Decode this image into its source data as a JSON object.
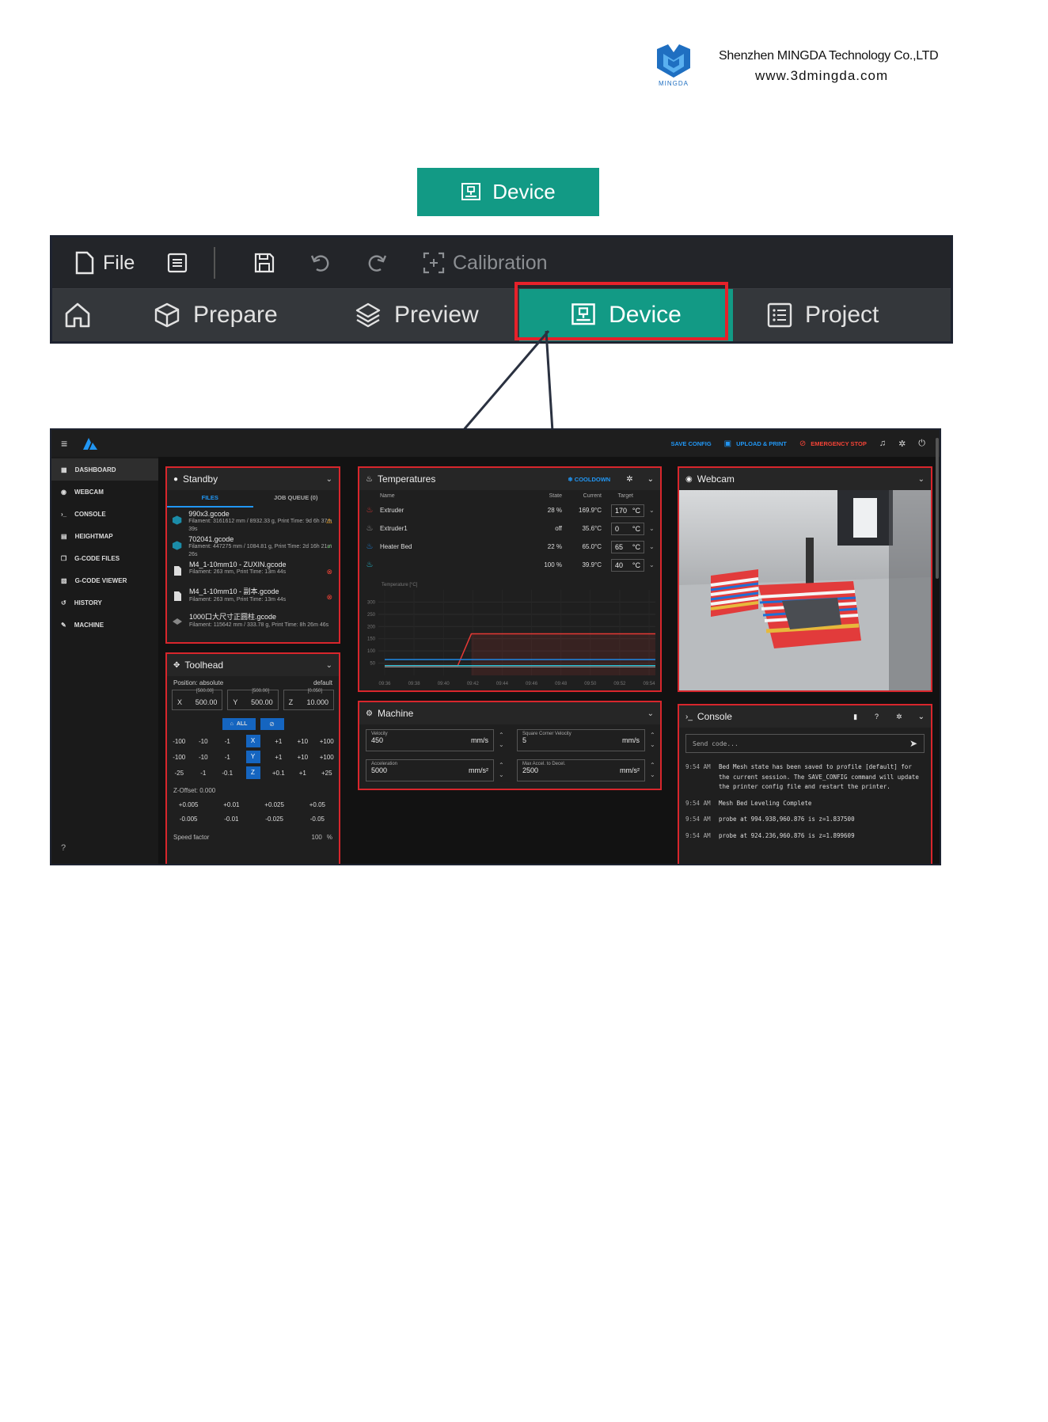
{
  "header": {
    "logo_text": "MINGDA",
    "company": "Shenzhen MINGDA Technology Co.,LTD",
    "website": "www.3dmingda.com"
  },
  "device_button": {
    "label": "Device",
    "color": "#129a85"
  },
  "slicer": {
    "toolbar": {
      "file": "File",
      "calibration": "Calibration"
    },
    "tabs": {
      "prepare": "Prepare",
      "preview": "Preview",
      "device": "Device",
      "project": "Project"
    },
    "highlight_color": "#e6212a"
  },
  "dashboard": {
    "topbar": {
      "save_config": "SAVE CONFIG",
      "upload_print": "UPLOAD & PRINT",
      "emergency_stop": "EMERGENCY STOP"
    },
    "nav": [
      "DASHBOARD",
      "WEBCAM",
      "CONSOLE",
      "HEIGHTMAP",
      "G-CODE FILES",
      "G-CODE VIEWER",
      "HISTORY",
      "MACHINE"
    ],
    "standby": {
      "title": "Standby",
      "tab_files": "FILES",
      "tab_queue": "JOB QUEUE (0)",
      "files": [
        {
          "name": "990x3.gcode",
          "meta": "Filament: 3161612 mm / 8932.33 g, Print Time: 9d 6h 37m 39s",
          "status": "warning"
        },
        {
          "name": "702041.gcode",
          "meta": "Filament: 447275 mm / 1084.81 g, Print Time: 2d 16h 21m 26s",
          "status": "ok"
        },
        {
          "name": "M4_1-10mm10 - ZUXIN.gcode",
          "meta": "Filament: 263 mm, Print Time: 13m 44s",
          "status": "error"
        },
        {
          "name": "M4_1-10mm10 - 副本.gcode",
          "meta": "Filament: 263 mm, Print Time: 13m 44s",
          "status": "error"
        },
        {
          "name": "1000口大尺寸正圆柱.gcode",
          "meta": "Filament: 115642 mm / 333.78 g, Print Time: 8h 26m 46s",
          "status": "none"
        }
      ]
    },
    "toolhead": {
      "title": "Toolhead",
      "position_label": "Position: absolute",
      "default_label": "default",
      "x": {
        "label": "X",
        "value": "500.00",
        "max": "[500.00]"
      },
      "y": {
        "label": "Y",
        "value": "500.00",
        "max": "[500.00]"
      },
      "z": {
        "label": "Z",
        "value": "10.000",
        "max": "[0.050]"
      },
      "all_label": "ALL",
      "jog_rows": [
        [
          "-100",
          "-10",
          "-1",
          "X",
          "+1",
          "+10",
          "+100"
        ],
        [
          "-100",
          "-10",
          "-1",
          "Y",
          "+1",
          "+10",
          "+100"
        ],
        [
          "-25",
          "-1",
          "-0.1",
          "Z",
          "+0.1",
          "+1",
          "+25"
        ]
      ],
      "zoffset_label": "Z-Offset: 0.000",
      "zoff_up": [
        "+0.005",
        "+0.01",
        "+0.025",
        "+0.05"
      ],
      "zoff_down": [
        "-0.005",
        "-0.01",
        "-0.025",
        "-0.05"
      ],
      "speed_label": "Speed factor",
      "speed_value": "100",
      "speed_unit": "%"
    },
    "temperatures": {
      "title": "Temperatures",
      "cooldown": "COOLDOWN",
      "headers": [
        "Name",
        "State",
        "Current",
        "Target"
      ],
      "rows": [
        {
          "name": "Extruder",
          "state": "28 %",
          "current": "169.9°C",
          "target": "170",
          "unit": "°C",
          "color": "#e53935"
        },
        {
          "name": "Extruder1",
          "state": "off",
          "current": "35.6°C",
          "target": "0",
          "unit": "°C",
          "color": "#9e9e9e"
        },
        {
          "name": "Heater Bed",
          "state": "22 %",
          "current": "65.0°C",
          "target": "65",
          "unit": "°C",
          "color": "#1e88e5"
        },
        {
          "name": "",
          "state": "100 %",
          "current": "39.9°C",
          "target": "40",
          "unit": "°C",
          "color": "#26c6da"
        }
      ],
      "chart_label": "Temperature [°C]",
      "y_ticks": [
        "300",
        "250",
        "200",
        "150",
        "100",
        "50"
      ],
      "x_ticks": [
        "09:36",
        "09:38",
        "09:40",
        "09:42",
        "09:44",
        "09:46",
        "09:48",
        "09:50",
        "09:52",
        "09:54"
      ]
    },
    "machine": {
      "title": "Machine",
      "velocity": {
        "label": "Velocity",
        "value": "450",
        "unit": "mm/s"
      },
      "scv": {
        "label": "Square Corner Velocity",
        "value": "5",
        "unit": "mm/s"
      },
      "accel": {
        "label": "Acceleration",
        "value": "5000",
        "unit": "mm/s²"
      },
      "accel_decel": {
        "label": "Max Accel. to Decel.",
        "value": "2500",
        "unit": "mm/s²"
      }
    },
    "webcam": {
      "title": "Webcam"
    },
    "console": {
      "title": "Console",
      "placeholder": "Send code...",
      "lines": [
        {
          "time": "9:54 AM",
          "text": "Bed Mesh state has been saved to profile [default] for the current session. The SAVE_CONFIG command will update the printer config file and restart the printer."
        },
        {
          "time": "9:54 AM",
          "text": "Mesh Bed Leveling Complete"
        },
        {
          "time": "9:54 AM",
          "text": "probe at 994.938,960.876 is z=1.837500"
        },
        {
          "time": "9:54 AM",
          "text": "probe at 924.236,960.876 is z=1.899609"
        }
      ]
    }
  }
}
